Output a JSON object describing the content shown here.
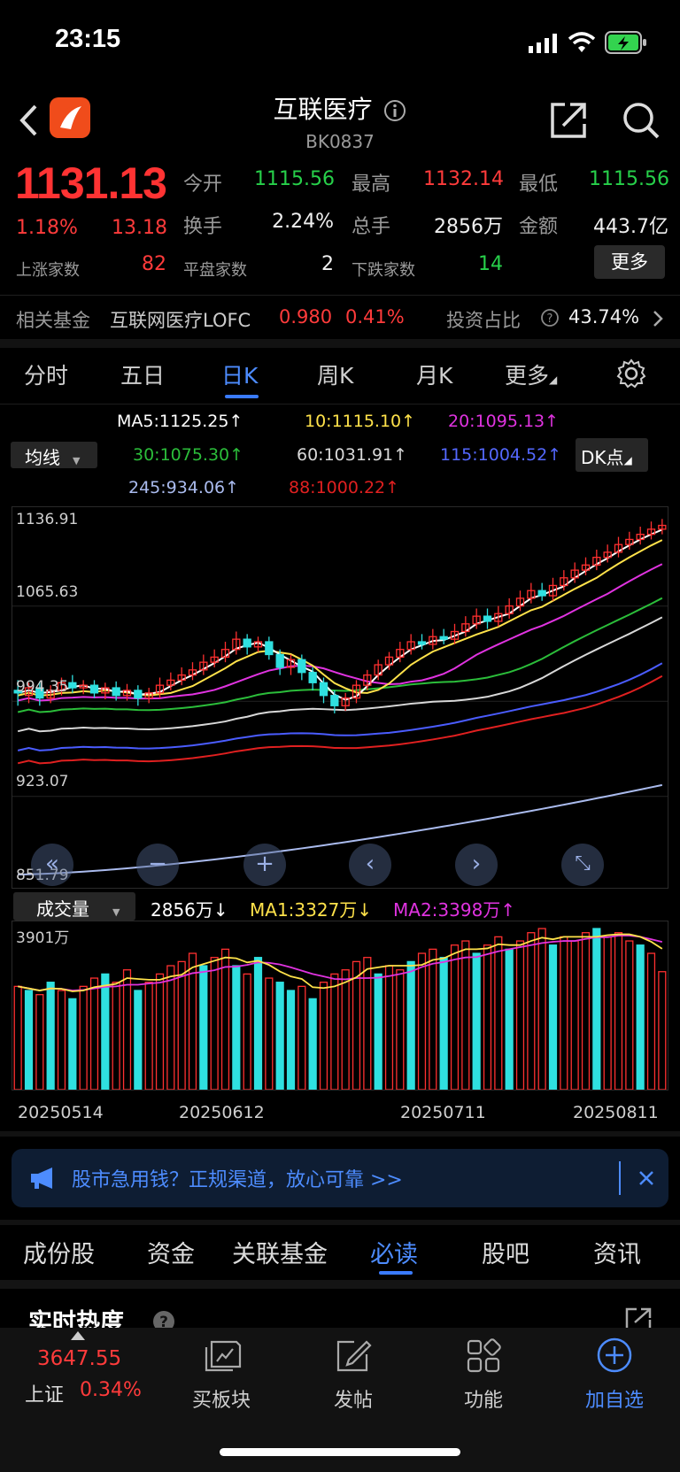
{
  "status_bar": {
    "time": "23:15"
  },
  "header": {
    "title": "互联医疗",
    "code": "BK0837"
  },
  "quote": {
    "price": "1131.13",
    "change_pct": "1.18%",
    "change": "13.18",
    "open_label": "今开",
    "open": "1115.56",
    "high_label": "最高",
    "high": "1132.14",
    "low_label": "最低",
    "low": "1115.56",
    "turnover_label": "换手",
    "turnover": "2.24%",
    "volume_label": "总手",
    "volume": "2856万",
    "amount_label": "金额",
    "amount": "443.7亿",
    "up_label": "上涨家数",
    "up_count": "82",
    "flat_label": "平盘家数",
    "flat_count": "2",
    "down_label": "下跌家数",
    "down_count": "14",
    "more_label": "更多"
  },
  "fund": {
    "label": "相关基金",
    "name": "互联网医疗LOFC",
    "price": "0.980",
    "pct": "0.41%",
    "ratio_label": "投资占比",
    "ratio": "43.74%"
  },
  "period_tabs": [
    {
      "label": "分时"
    },
    {
      "label": "五日"
    },
    {
      "label": "日K"
    },
    {
      "label": "周K"
    },
    {
      "label": "月K"
    },
    {
      "label": "更多"
    }
  ],
  "ma": {
    "selector": "均线",
    "ma5": "MA5:1125.25↑",
    "ma10": "10:1115.10↑",
    "ma20": "20:1095.13↑",
    "ma30": "30:1075.30↑",
    "ma60": "60:1031.91↑",
    "ma115": "115:1004.52↑",
    "ma245": "245:934.06↑",
    "ma88": "88:1000.22↑",
    "dk": "DK点"
  },
  "colors": {
    "ma5": "#ffffff",
    "ma10": "#ffe24a",
    "ma20": "#e033e0",
    "ma30": "#2bbd3a",
    "ma60": "#d8d8d8",
    "ma115": "#4a5cff",
    "ma245": "#aabbee",
    "ma88": "#e02020",
    "up": "#ff3030",
    "down": "#2fe0e0"
  },
  "chart": {
    "y_ticks": [
      "1136.91",
      "1065.63",
      "994.35",
      "923.07",
      "851.79"
    ],
    "vol_max": "3901万",
    "x_ticks": [
      "20250514",
      "20250612",
      "20250711",
      "20250811"
    ]
  },
  "volume_header": {
    "selector": "成交量",
    "vol": "2856万↓",
    "ma1": "MA1:3327万↓",
    "ma2": "MA2:3398万↑"
  },
  "chart_data": {
    "type": "candlestick",
    "ylim": [
      851.79,
      1136.91
    ],
    "x_ticks": [
      "20250514",
      "20250612",
      "20250711",
      "20250811"
    ],
    "candles": [
      [
        1002,
        1000,
        1010,
        990
      ],
      [
        998,
        1004,
        1008,
        992
      ],
      [
        1004,
        996,
        1009,
        990
      ],
      [
        996,
        1002,
        1006,
        992
      ],
      [
        1002,
        1008,
        1012,
        998
      ],
      [
        1008,
        1004,
        1014,
        1000
      ],
      [
        1004,
        1006,
        1010,
        999
      ],
      [
        1006,
        1000,
        1010,
        996
      ],
      [
        1000,
        1004,
        1008,
        995
      ],
      [
        1004,
        998,
        1009,
        994
      ],
      [
        998,
        1002,
        1007,
        994
      ],
      [
        1002,
        996,
        1006,
        990
      ],
      [
        996,
        1000,
        1004,
        992
      ],
      [
        1000,
        1006,
        1012,
        996
      ],
      [
        1006,
        1010,
        1016,
        1002
      ],
      [
        1010,
        1014,
        1020,
        1006
      ],
      [
        1014,
        1018,
        1024,
        1010
      ],
      [
        1018,
        1024,
        1030,
        1014
      ],
      [
        1024,
        1028,
        1034,
        1020
      ],
      [
        1028,
        1034,
        1040,
        1024
      ],
      [
        1034,
        1042,
        1048,
        1030
      ],
      [
        1042,
        1036,
        1046,
        1030
      ],
      [
        1036,
        1040,
        1044,
        1032
      ],
      [
        1040,
        1030,
        1044,
        1026
      ],
      [
        1030,
        1020,
        1034,
        1014
      ],
      [
        1020,
        1026,
        1030,
        1014
      ],
      [
        1026,
        1016,
        1030,
        1010
      ],
      [
        1016,
        1008,
        1020,
        1002
      ],
      [
        1008,
        998,
        1012,
        992
      ],
      [
        998,
        990,
        1002,
        984
      ],
      [
        990,
        996,
        1000,
        986
      ],
      [
        996,
        1006,
        1010,
        992
      ],
      [
        1006,
        1014,
        1018,
        1002
      ],
      [
        1014,
        1022,
        1026,
        1010
      ],
      [
        1022,
        1028,
        1032,
        1018
      ],
      [
        1028,
        1034,
        1040,
        1024
      ],
      [
        1034,
        1040,
        1046,
        1030
      ],
      [
        1040,
        1038,
        1046,
        1034
      ],
      [
        1038,
        1044,
        1050,
        1034
      ],
      [
        1044,
        1042,
        1050,
        1038
      ],
      [
        1042,
        1048,
        1054,
        1038
      ],
      [
        1048,
        1054,
        1060,
        1044
      ],
      [
        1054,
        1060,
        1066,
        1050
      ],
      [
        1060,
        1056,
        1066,
        1050
      ],
      [
        1056,
        1062,
        1068,
        1052
      ],
      [
        1062,
        1068,
        1074,
        1058
      ],
      [
        1068,
        1074,
        1080,
        1064
      ],
      [
        1074,
        1080,
        1086,
        1070
      ],
      [
        1080,
        1076,
        1086,
        1072
      ],
      [
        1076,
        1084,
        1090,
        1072
      ],
      [
        1084,
        1090,
        1096,
        1080
      ],
      [
        1090,
        1096,
        1102,
        1086
      ],
      [
        1096,
        1100,
        1106,
        1092
      ],
      [
        1100,
        1106,
        1112,
        1096
      ],
      [
        1106,
        1110,
        1116,
        1102
      ],
      [
        1110,
        1116,
        1122,
        1106
      ],
      [
        1116,
        1120,
        1126,
        1112
      ],
      [
        1120,
        1124,
        1130,
        1116
      ],
      [
        1124,
        1128,
        1134,
        1120
      ],
      [
        1128,
        1131,
        1136,
        1124
      ]
    ],
    "volumes": [
      [
        2500,
        1
      ],
      [
        2400,
        0
      ],
      [
        2300,
        1
      ],
      [
        2600,
        0
      ],
      [
        2400,
        1
      ],
      [
        2200,
        0
      ],
      [
        2500,
        1
      ],
      [
        2700,
        1
      ],
      [
        2800,
        0
      ],
      [
        2600,
        1
      ],
      [
        2900,
        1
      ],
      [
        2400,
        0
      ],
      [
        2600,
        1
      ],
      [
        2800,
        1
      ],
      [
        3000,
        1
      ],
      [
        3100,
        1
      ],
      [
        3300,
        1
      ],
      [
        3000,
        0
      ],
      [
        3200,
        1
      ],
      [
        3400,
        1
      ],
      [
        3000,
        0
      ],
      [
        2800,
        1
      ],
      [
        3200,
        0
      ],
      [
        2700,
        1
      ],
      [
        2600,
        0
      ],
      [
        2400,
        0
      ],
      [
        2500,
        1
      ],
      [
        2200,
        0
      ],
      [
        2600,
        1
      ],
      [
        2800,
        1
      ],
      [
        2900,
        1
      ],
      [
        3100,
        1
      ],
      [
        3200,
        1
      ],
      [
        2800,
        0
      ],
      [
        3000,
        1
      ],
      [
        2900,
        1
      ],
      [
        3100,
        0
      ],
      [
        3300,
        1
      ],
      [
        3400,
        1
      ],
      [
        3200,
        0
      ],
      [
        3500,
        1
      ],
      [
        3600,
        1
      ],
      [
        3300,
        0
      ],
      [
        3500,
        1
      ],
      [
        3700,
        1
      ],
      [
        3400,
        0
      ],
      [
        3600,
        1
      ],
      [
        3800,
        1
      ],
      [
        3900,
        1
      ],
      [
        3500,
        0
      ],
      [
        3700,
        1
      ],
      [
        3600,
        1
      ],
      [
        3800,
        1
      ],
      [
        3900,
        0
      ],
      [
        3700,
        1
      ],
      [
        3800,
        1
      ],
      [
        3600,
        1
      ],
      [
        3500,
        0
      ],
      [
        3300,
        1
      ],
      [
        2856,
        1
      ]
    ]
  },
  "banner": {
    "text": "股市急用钱？正规渠道，放心可靠 >>"
  },
  "bottom_tabs": [
    {
      "label": "成份股"
    },
    {
      "label": "资金"
    },
    {
      "label": "关联基金"
    },
    {
      "label": "必读"
    },
    {
      "label": "股吧"
    },
    {
      "label": "资讯"
    }
  ],
  "section": {
    "title": "实时热度"
  },
  "index": {
    "value": "3647.55",
    "name": "上证",
    "pct": "0.34%"
  },
  "nav": {
    "plates": "买板块",
    "post": "发帖",
    "func": "功能",
    "watch": "加自选"
  }
}
